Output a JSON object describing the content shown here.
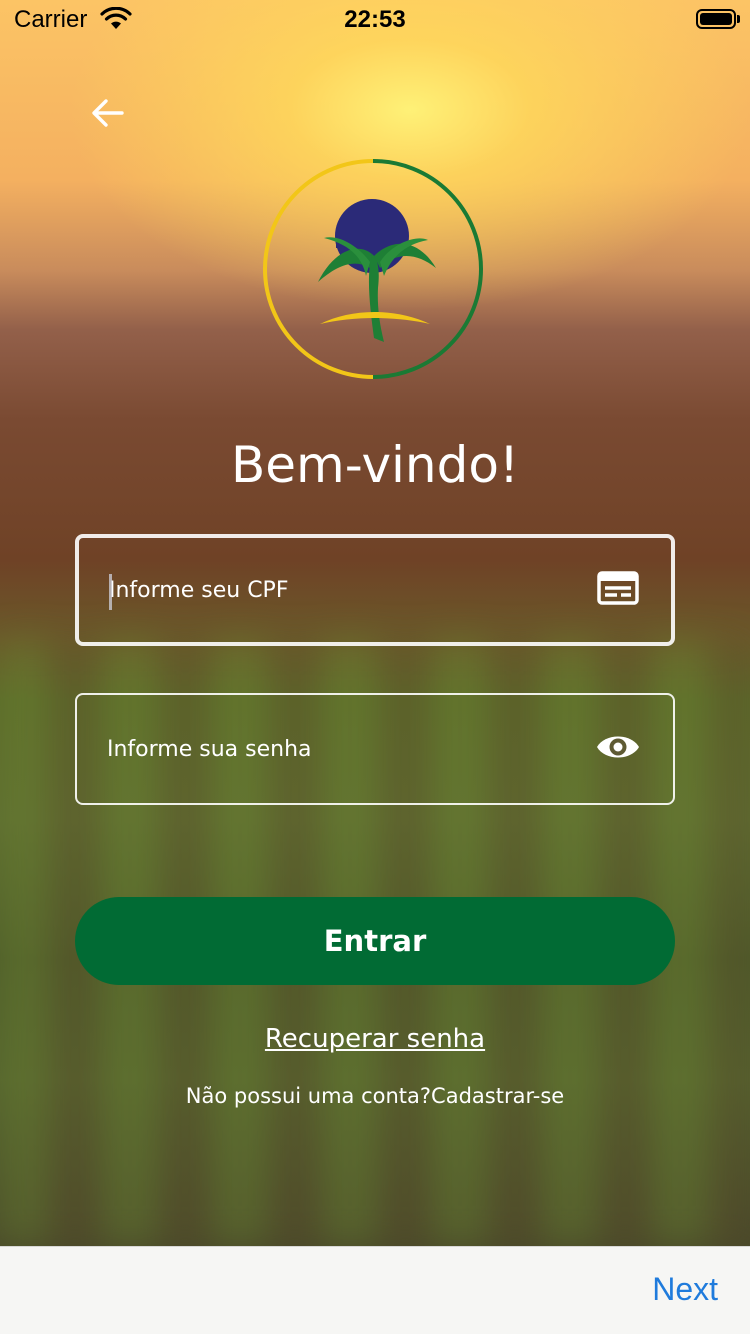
{
  "status_bar": {
    "carrier": "Carrier",
    "time": "22:53",
    "icons": [
      "wifi-icon",
      "battery-icon"
    ]
  },
  "header": {
    "back_icon": "arrow-left-icon"
  },
  "logo": {
    "name": "sun-plant-circle-logo",
    "colors": {
      "ring_yellow": "#f2c618",
      "ring_green": "#1a7a34",
      "sun_navy": "#2b2a78",
      "leaf_green": "#1e7f35",
      "arc_yellow": "#f2c618"
    }
  },
  "welcome": {
    "title": "Bem-vindo!"
  },
  "form": {
    "cpf": {
      "value": "",
      "placeholder": "Informe seu CPF",
      "icon": "id-card-icon"
    },
    "password": {
      "value": "",
      "placeholder": "Informe sua senha",
      "icon": "eye-icon"
    },
    "submit_label": "Entrar"
  },
  "links": {
    "recover": "Recuperar senha",
    "no_account": "Não possui uma conta?",
    "signup": "Cadastrar-se"
  },
  "keyboard_bar": {
    "next_label": "Next"
  },
  "colors": {
    "primary_button": "#016b34",
    "link_blue": "#1f7bdc",
    "text_white": "#ffffff"
  }
}
